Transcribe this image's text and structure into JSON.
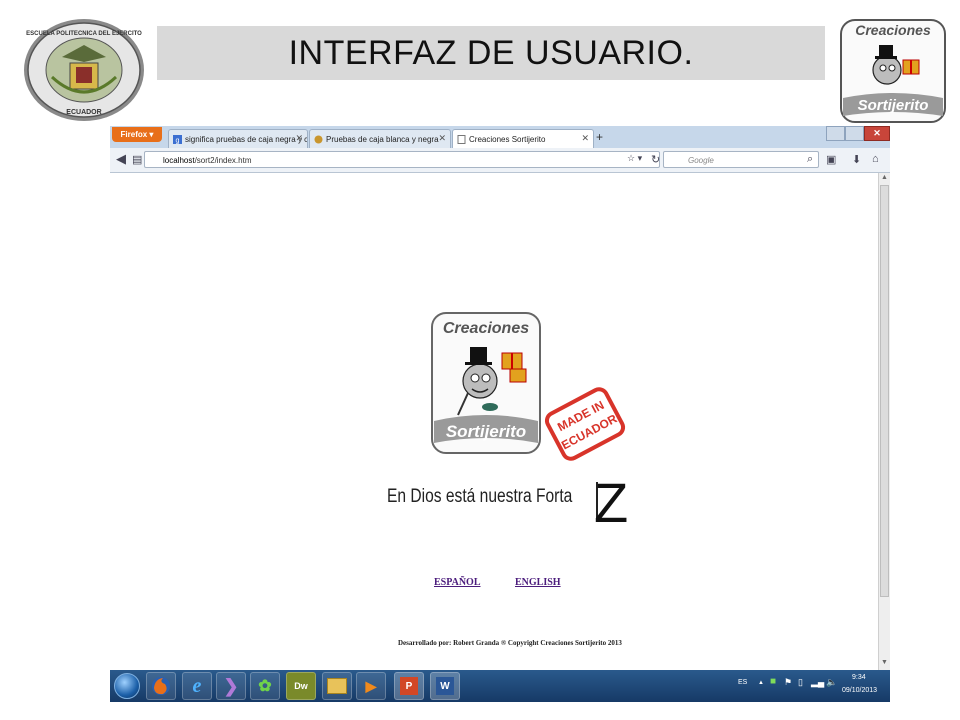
{
  "slide": {
    "title": "INTERFAZ DE USUARIO."
  },
  "seal": {
    "top_text": "ESCUELA POLITECNICA DEL EJERCITO",
    "bottom_text": "ECUADOR"
  },
  "brand_logo": {
    "line1": "Creaciones",
    "line2": "Sortijerito"
  },
  "stamp": {
    "line1": "MADE IN",
    "line2": "ECUADOR"
  },
  "browser": {
    "menu_button": "Firefox",
    "tabs": [
      {
        "label": "significa pruebas de caja negra y caja ...",
        "active": false
      },
      {
        "label": "Pruebas de caja blanca y negra",
        "active": false
      },
      {
        "label": "Creaciones Sortijerito",
        "active": true
      }
    ],
    "url_host": "localhost",
    "url_path": "/sort2/index.htm",
    "search_placeholder": "Google"
  },
  "page": {
    "motto": "En Dios está nuestra Forta",
    "cursor_glyph": "Z",
    "lang_es": "ESPAÑOL",
    "lang_en": "ENGLISH",
    "credit": "Desarrollado por: Robert Granda ® Copyright Creaciones Sortijerito 2013"
  },
  "taskbar": {
    "apps": [
      "firefox",
      "internet-explorer",
      "media",
      "vuze",
      "Dw",
      "folder",
      "player",
      "powerpoint",
      "W"
    ],
    "lang": "ES",
    "time": "9:34",
    "date": "09/10/2013"
  },
  "colors": {
    "title_band": "#d9d9d9",
    "link": "#4b1c7c",
    "taskbar": "#1e4a7a",
    "firefox_orange": "#e86f1a",
    "stamp_red": "#d8342a"
  }
}
